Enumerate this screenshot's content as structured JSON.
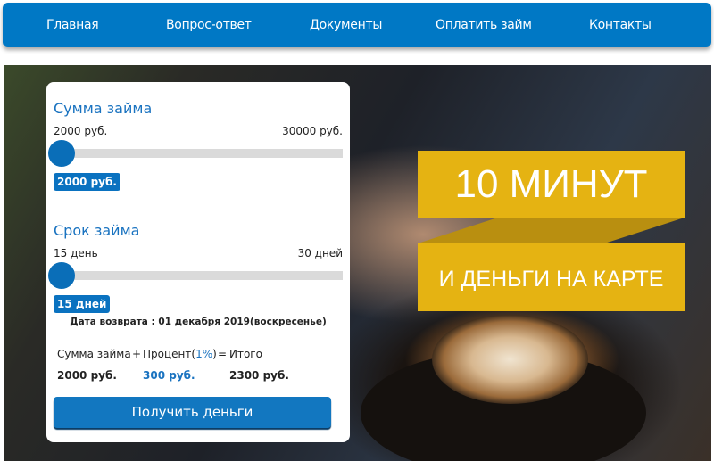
{
  "nav": [
    "Главная",
    "Вопрос-ответ",
    "Документы",
    "Оплатить займ",
    "Контакты"
  ],
  "banner": {
    "line1": "10 МИНУТ",
    "line2": "И ДЕНЬГИ НА КАРТЕ",
    "color": "#e5b312"
  },
  "calc": {
    "amount": {
      "title": "Сумма займа",
      "min": "2000 руб.",
      "max": "30000 руб.",
      "value": "2000 руб.",
      "fraction": 0
    },
    "term": {
      "title": "Срок займа",
      "min": "15 день",
      "max": "30 дней",
      "value": "15 дней",
      "fraction": 0
    },
    "return_date": "Дата возврата : 01 декабря 2019(воскресенье)",
    "summary": {
      "label_sum": "Сумма займа",
      "plus": "+",
      "label_pct": "Процент(",
      "pct": "1%",
      "pct_close": ")",
      "eq": "=",
      "label_total": "Итого",
      "sum": "2000 руб.",
      "interest": "300 руб.",
      "total": "2300 руб."
    },
    "button": "Получить деньги"
  }
}
